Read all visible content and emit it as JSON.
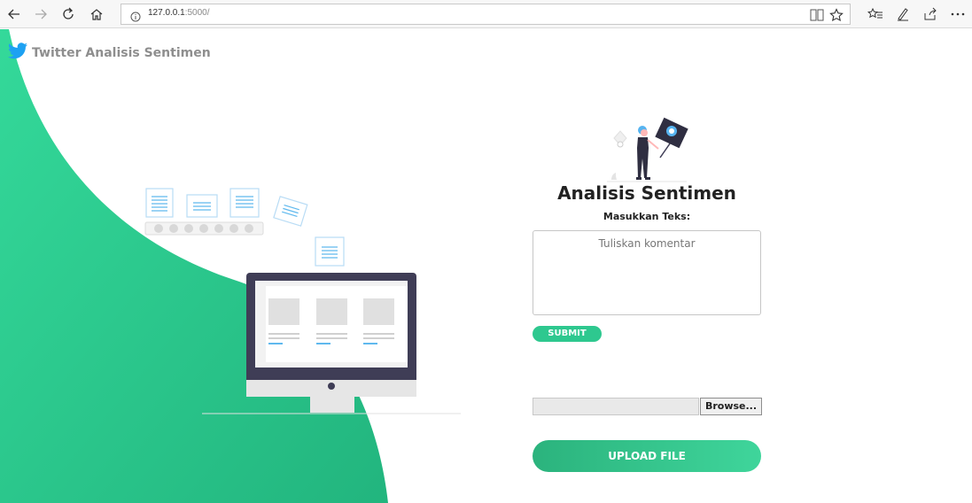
{
  "browser": {
    "url_host": "127.0.0.1",
    "url_port": ":5000/"
  },
  "brand": {
    "name": "Twitter Analisis Sentimen"
  },
  "form": {
    "title": "Analisis Sentimen",
    "label": "Masukkan Teks:",
    "textarea_placeholder": "Tuliskan komentar",
    "submit_label": "SUBMIT",
    "browse_label": "Browse...",
    "upload_label": "UPLOAD FILE"
  },
  "colors": {
    "brand_green": "#2ec88f",
    "twitter_blue": "#1da1f2"
  },
  "icons": {
    "back": "arrow-left-icon",
    "forward": "arrow-right-icon",
    "refresh": "refresh-icon",
    "home": "home-icon",
    "info": "info-icon",
    "reading": "reading-view-icon",
    "favorite": "star-icon",
    "favorites_bar": "favorites-icon",
    "pen": "pen-icon",
    "share": "share-icon",
    "more": "more-icon",
    "twitter": "twitter-bird-icon"
  }
}
